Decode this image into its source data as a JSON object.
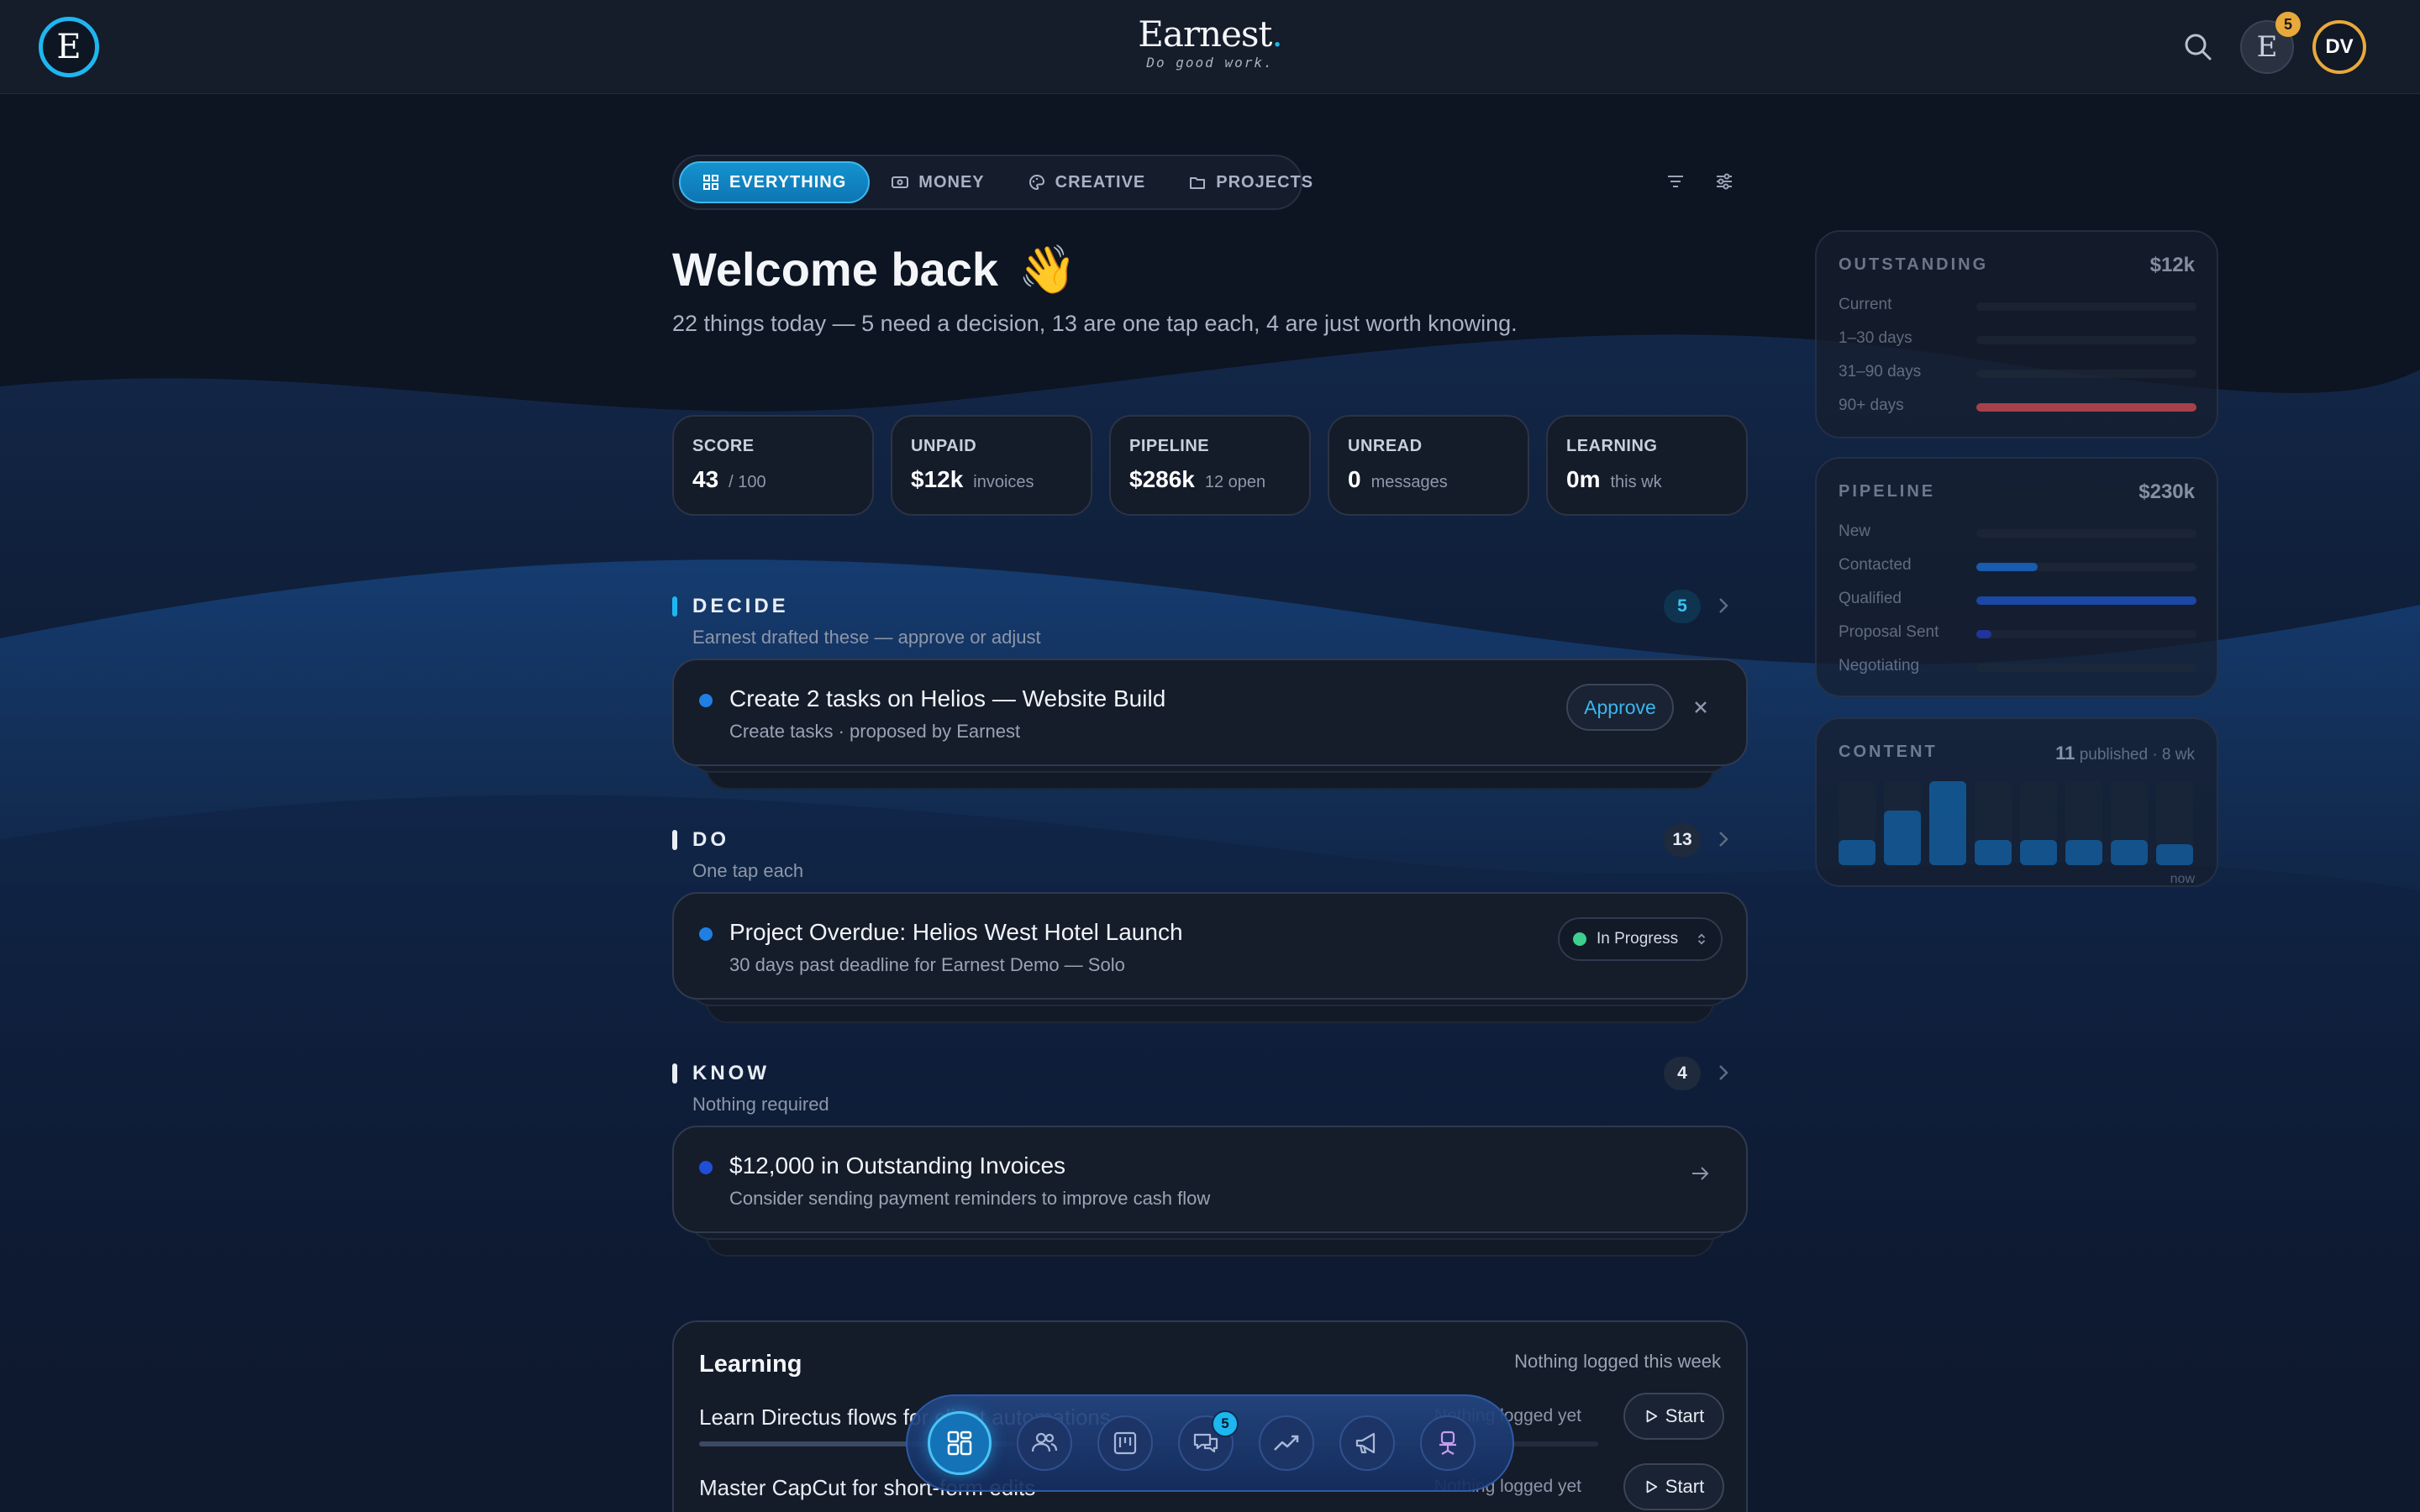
{
  "brand": {
    "logo_letter": "E",
    "name": "Earnest",
    "tagline": "Do good work."
  },
  "topbar": {
    "notif_count": "5",
    "avatar_initials": "DV",
    "eicon_letter": "E"
  },
  "tabs": [
    {
      "label": "EVERYTHING",
      "icon": "grid-icon",
      "active": true
    },
    {
      "label": "MONEY",
      "icon": "cash-icon"
    },
    {
      "label": "CREATIVE",
      "icon": "palette-icon"
    },
    {
      "label": "PROJECTS",
      "icon": "folder-icon"
    }
  ],
  "welcome": {
    "title": "Welcome back",
    "emoji": "👋",
    "subtitle": "22 things today — 5 need a decision, 13 are one tap each, 4 are just worth knowing."
  },
  "stats": [
    {
      "label": "SCORE",
      "value": "43",
      "sub": "/ 100"
    },
    {
      "label": "UNPAID",
      "value": "$12k",
      "sub": "invoices"
    },
    {
      "label": "PIPELINE",
      "value": "$286k",
      "sub": "12 open"
    },
    {
      "label": "UNREAD",
      "value": "0",
      "sub": "messages"
    },
    {
      "label": "LEARNING",
      "value": "0m",
      "sub": "this wk"
    }
  ],
  "sections": {
    "decide": {
      "title": "DECIDE",
      "count": "5",
      "desc": "Earnest drafted these — approve or adjust",
      "bar_color": "#1fb6ef",
      "card": {
        "title": "Create 2 tasks on Helios — Website Build",
        "sub": "Create tasks · proposed by Earnest",
        "action": "Approve"
      }
    },
    "do": {
      "title": "DO",
      "count": "13",
      "desc": "One tap each",
      "bar_color": "#e9edf4",
      "card": {
        "title": "Project Overdue: Helios West Hotel Launch",
        "sub": "30 days past deadline for Earnest Demo — Solo",
        "status": "In Progress"
      }
    },
    "know": {
      "title": "KNOW",
      "count": "4",
      "desc": "Nothing required",
      "bar_color": "#e9edf4",
      "card": {
        "title": "$12,000 in Outstanding Invoices",
        "sub": "Consider sending payment reminders to improve cash flow"
      }
    }
  },
  "learning": {
    "title": "Learning",
    "note": "Nothing logged this week",
    "items": [
      {
        "name": "Learn Directus flows for client automations",
        "status": "Nothing logged yet",
        "action": "Start"
      },
      {
        "name": "Master CapCut for short-form edits",
        "status": "Nothing logged yet",
        "action": "Start"
      }
    ]
  },
  "dock": {
    "items": [
      "dashboard-icon",
      "people-icon",
      "board-icon",
      "chat-icon",
      "trend-icon",
      "megaphone-icon",
      "chair-icon"
    ],
    "chat_badge": "5"
  },
  "panels": {
    "outstanding": {
      "title": "OUTSTANDING",
      "total": "$12k",
      "rows": [
        {
          "label": "Current",
          "fraction": 0,
          "color": "#c0464a"
        },
        {
          "label": "1–30 days",
          "fraction": 0,
          "color": "#c0464a"
        },
        {
          "label": "31–90 days",
          "fraction": 0,
          "color": "#c0464a"
        },
        {
          "label": "90+ days",
          "fraction": 1.0,
          "color": "#c0464a"
        }
      ]
    },
    "pipeline": {
      "title": "PIPELINE",
      "total": "$230k",
      "rows": [
        {
          "label": "New",
          "fraction": 0,
          "color": "#1a66c4"
        },
        {
          "label": "Contacted",
          "fraction": 0.28,
          "color": "#1a66c4"
        },
        {
          "label": "Qualified",
          "fraction": 1.0,
          "color": "#1d4fb8"
        },
        {
          "label": "Proposal Sent",
          "fraction": 0.07,
          "color": "#2438b0"
        },
        {
          "label": "Negotiating",
          "fraction": 0,
          "color": "#1a66c4"
        }
      ]
    },
    "content": {
      "title": "CONTENT",
      "published_count": "11",
      "published_text": "published · 8 wk",
      "now_label": "now",
      "weeks": [
        0.3,
        0.65,
        1.0,
        0.3,
        0.3,
        0.3,
        0.3,
        0.25
      ]
    }
  }
}
